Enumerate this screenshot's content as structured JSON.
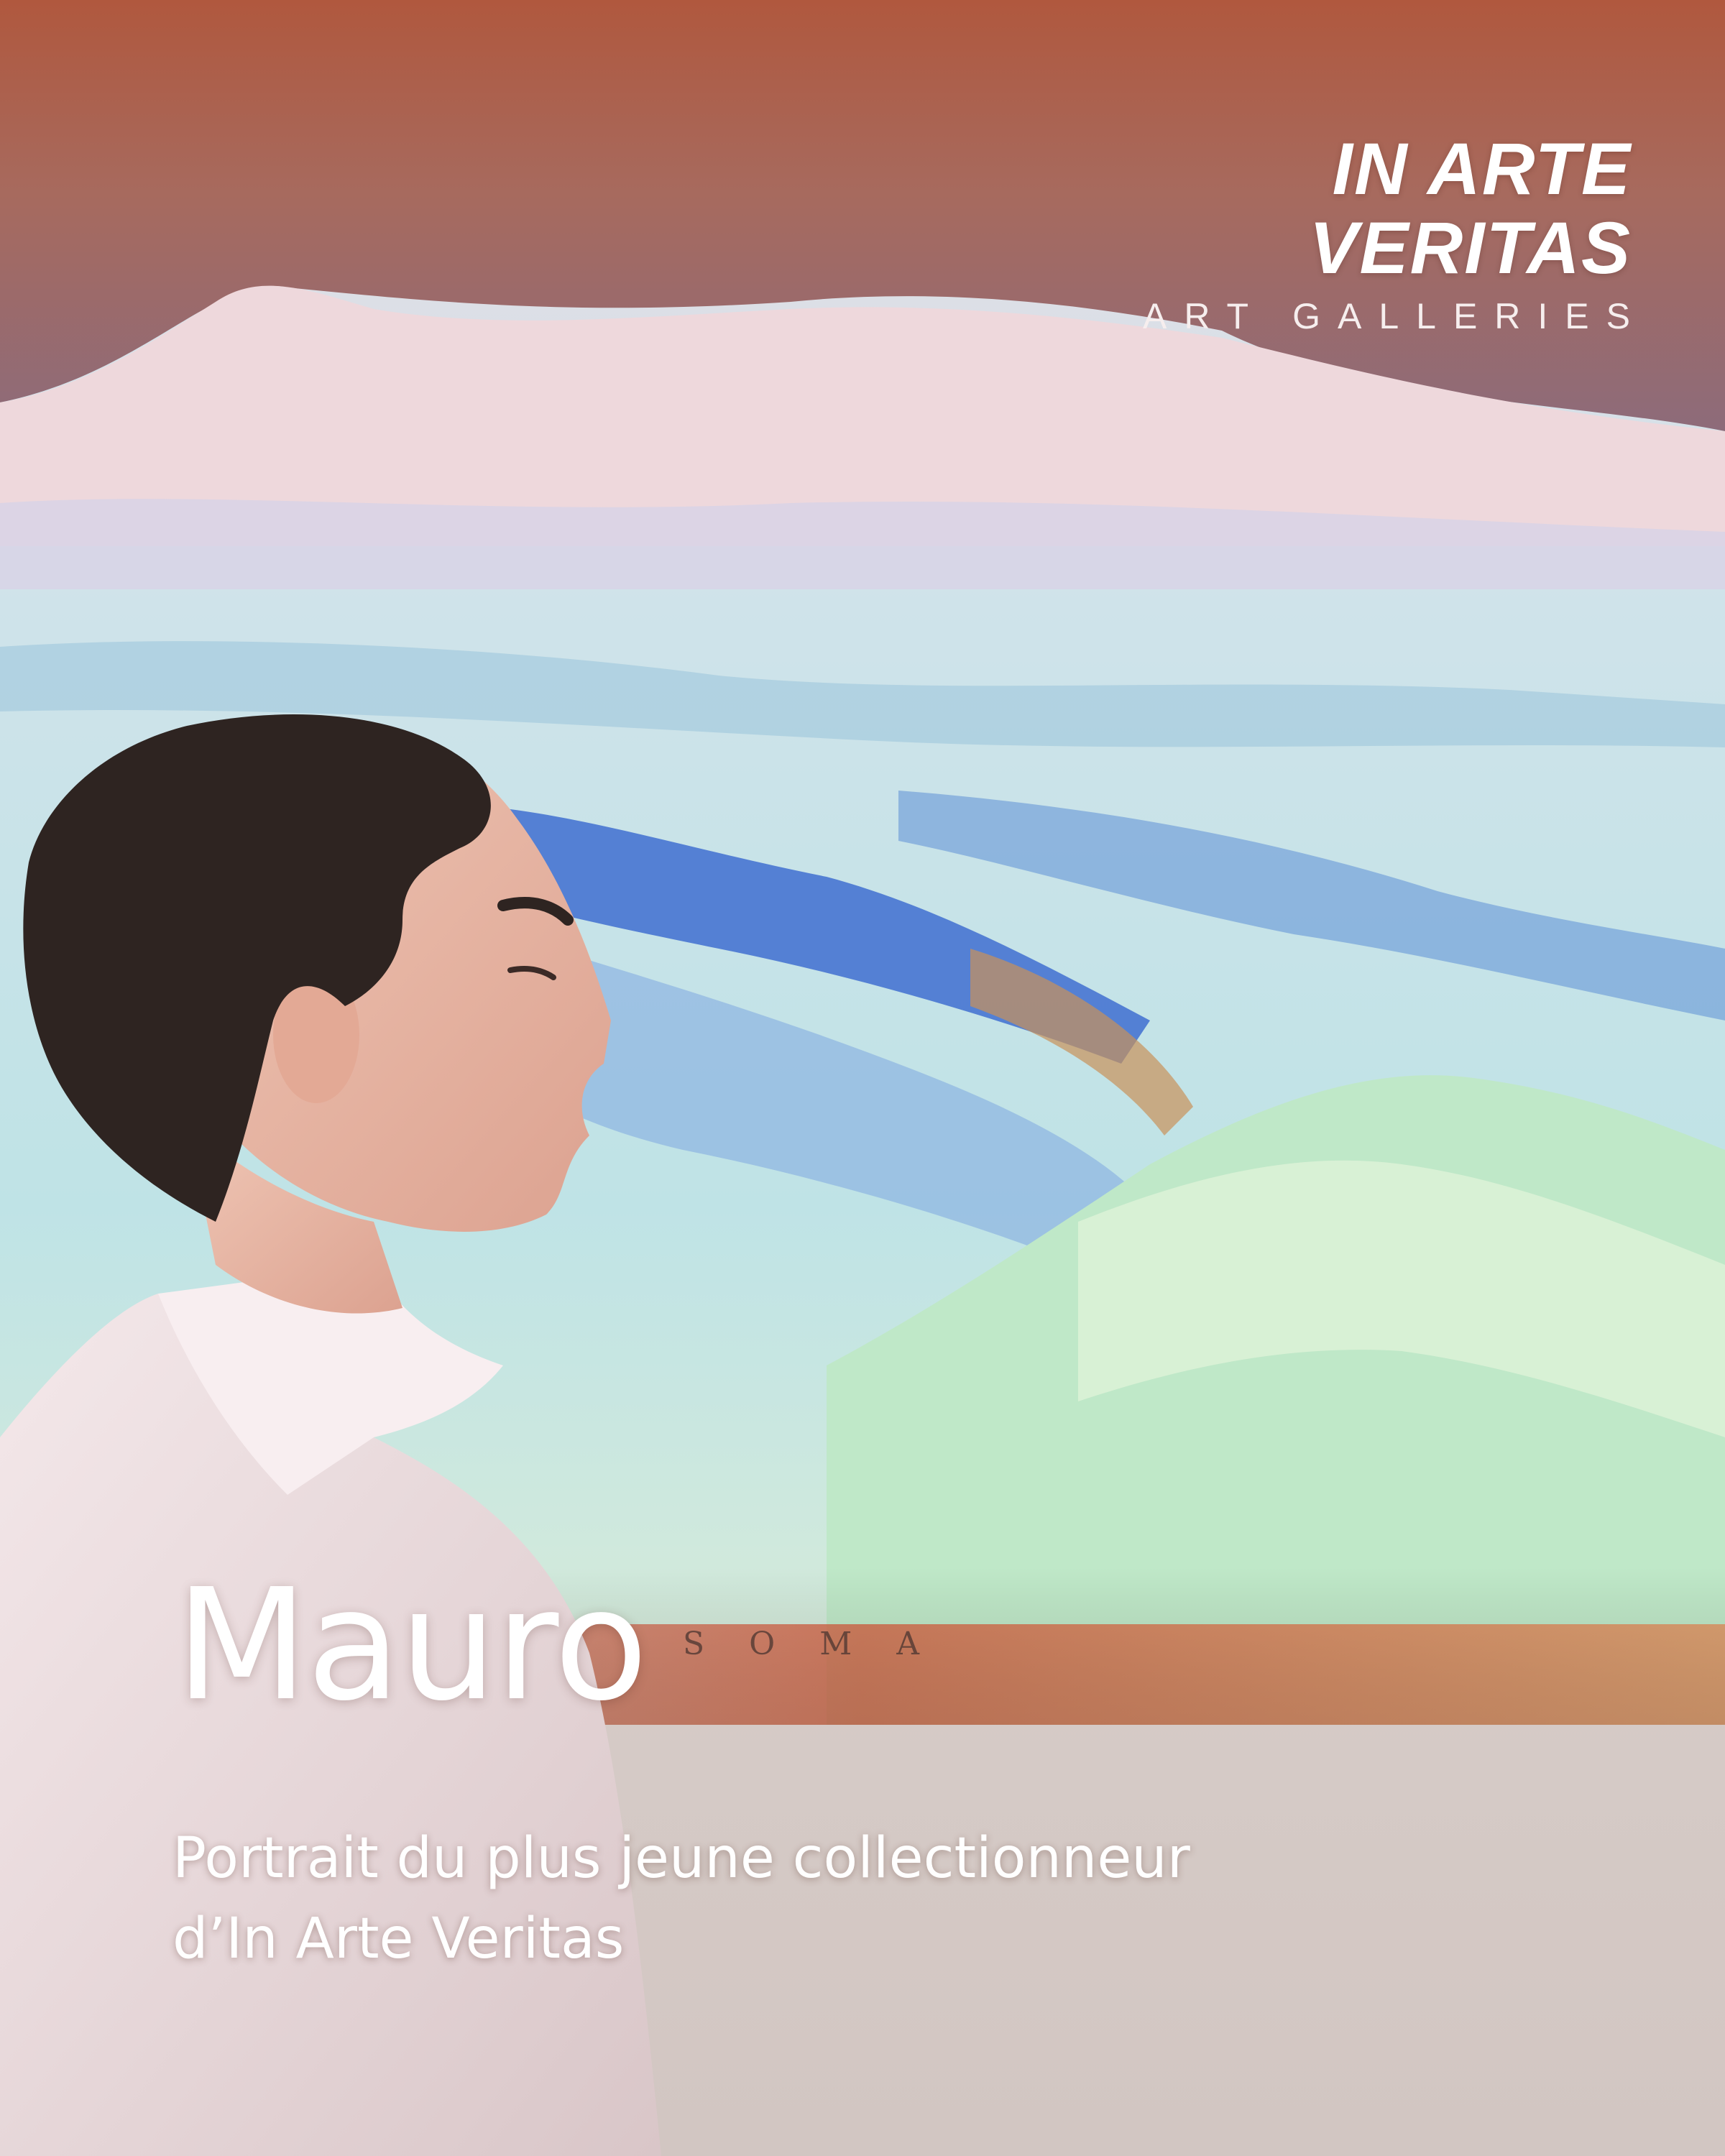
{
  "brand": {
    "name": "IN ARTE VERITAS",
    "tagline": "ART GALLERIES"
  },
  "artwork": {
    "signature": "SOMA"
  },
  "headline": {
    "title": "Mauro",
    "subtitle_line1": "Portrait du plus jeune collectionneur",
    "subtitle_line2": "d’In Arte Veritas"
  },
  "colors": {
    "text": "#ffffff",
    "sky_top": "#b86a4e",
    "sky_mid": "#9c6b6e",
    "ice_blue": "#3f6fd0",
    "ice_green": "#bfe8c8",
    "wall": "#d9cfcb"
  }
}
